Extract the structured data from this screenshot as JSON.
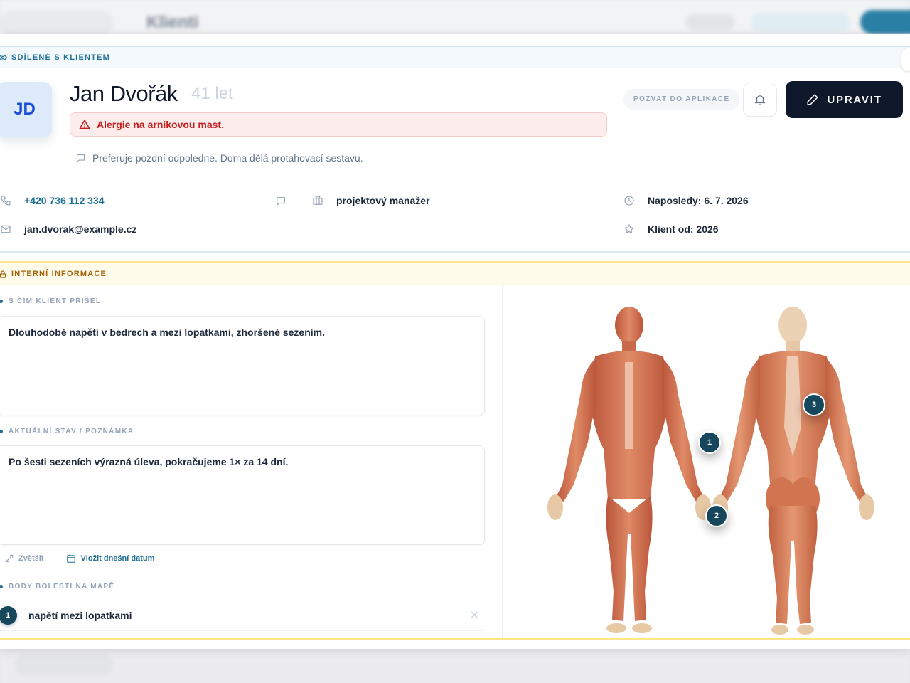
{
  "backdrop": {
    "page_title": "Klienti"
  },
  "shared_section": {
    "label": "SDÍLENÉ S KLIENTEM"
  },
  "client": {
    "initials": "JD",
    "name": "Jan Dvořák",
    "age": "41 let",
    "allergy": "Alergie na arnikovou mast.",
    "preference_note": "Preferuje pozdní odpoledne. Doma dělá protahovací sestavu.",
    "phone": "+420 736 112 334",
    "email": "jan.dvorak@example.cz",
    "occupation": "projektový manažer",
    "last_visit": "Naposledy: 6. 7. 2026",
    "client_since": "Klient od: 2026"
  },
  "actions": {
    "invite_label": "POZVAT DO APLIKACE",
    "edit_label": "UPRAVIT"
  },
  "internal_section": {
    "label": "INTERNÍ INFORMACE",
    "reason_label": "S ČÍM KLIENT PŘIŠEL",
    "reason_text": "Dlouhodobé napětí v bedrech a mezi lopatkami, zhoršené sezením.",
    "status_label": "AKTUÁLNÍ STAV / POZNÁMKA",
    "status_text": "Po šesti sezeních výrazná úleva, pokračujeme 1× za 14 dní.",
    "expand_label": "Zvětšit",
    "insert_date_label": "Vložit dnešní datum",
    "pain_points_label": "BODY BOLESTI NA MAPĚ",
    "pain_points": [
      {
        "number": "1",
        "text": "napětí mezi lopatkami"
      }
    ]
  },
  "body_map": {
    "markers": [
      {
        "number": "1"
      },
      {
        "number": "2"
      },
      {
        "number": "3"
      }
    ]
  },
  "colors": {
    "accent": "#1e6f93",
    "dark": "#0f172a",
    "alert": "#c81e1e",
    "internal": "#a16207",
    "marker": "#16475d"
  }
}
